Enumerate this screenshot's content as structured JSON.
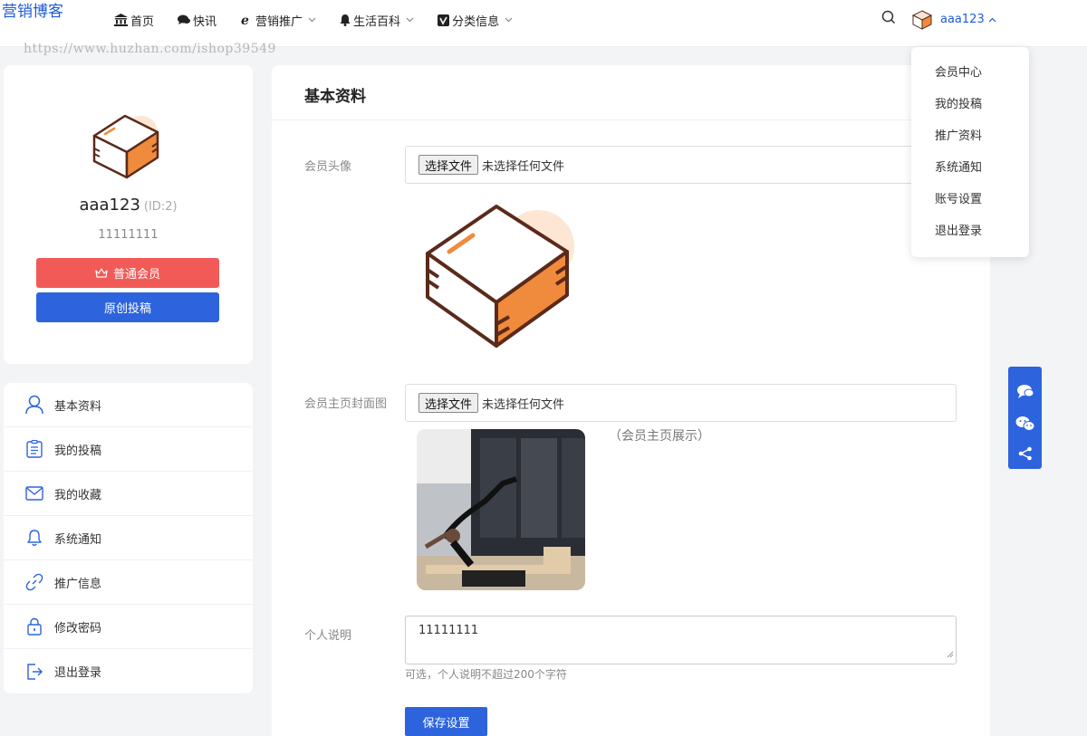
{
  "header": {
    "logo_alt": "营销博客",
    "nav": [
      {
        "label": "首页",
        "icon": "bank-icon",
        "has_dropdown": false
      },
      {
        "label": "快讯",
        "icon": "chat-icon",
        "has_dropdown": false
      },
      {
        "label": "营销推广",
        "icon": "ie-icon",
        "has_dropdown": true
      },
      {
        "label": "生活百科",
        "icon": "bell-icon",
        "has_dropdown": true
      },
      {
        "label": "分类信息",
        "icon": "vimeo-icon",
        "has_dropdown": true
      }
    ],
    "watermark": "https://www.huzhan.com/ishop39549",
    "username": "aaa123"
  },
  "profile": {
    "name": "aaa123",
    "id_text": "(ID:2)",
    "signature": "11111111",
    "member_button": "普通会员",
    "post_button": "原创投稿"
  },
  "menu": {
    "items": [
      {
        "label": "基本资料",
        "icon": "user-icon",
        "active": true
      },
      {
        "label": "我的投稿",
        "icon": "document-list-icon"
      },
      {
        "label": "我的收藏",
        "icon": "envelope-icon"
      },
      {
        "label": "系统通知",
        "icon": "bell-outline-icon"
      },
      {
        "label": "推广信息",
        "icon": "link-icon"
      },
      {
        "label": "修改密码",
        "icon": "lock-icon"
      },
      {
        "label": "退出登录",
        "icon": "logout-icon"
      }
    ]
  },
  "main": {
    "title": "基本资料",
    "avatar_label": "会员头像",
    "file_button": "选择文件",
    "file_none": "未选择任何文件",
    "cover_label": "会员主页封面图",
    "cover_caption": "（会员主页展示）",
    "bio_label": "个人说明",
    "bio_value": "11111111",
    "bio_hint": "可选，个人说明不超过200个字符",
    "save_button": "保存设置"
  },
  "dropdown": {
    "items": [
      "会员中心",
      "我的投稿",
      "推广资料",
      "系统通知",
      "账号设置",
      "退出登录"
    ]
  },
  "colors": {
    "primary": "#2d64dd",
    "member_red": "#f25a58",
    "box_orange": "#f08a3c",
    "box_outline": "#5a2a1a"
  }
}
